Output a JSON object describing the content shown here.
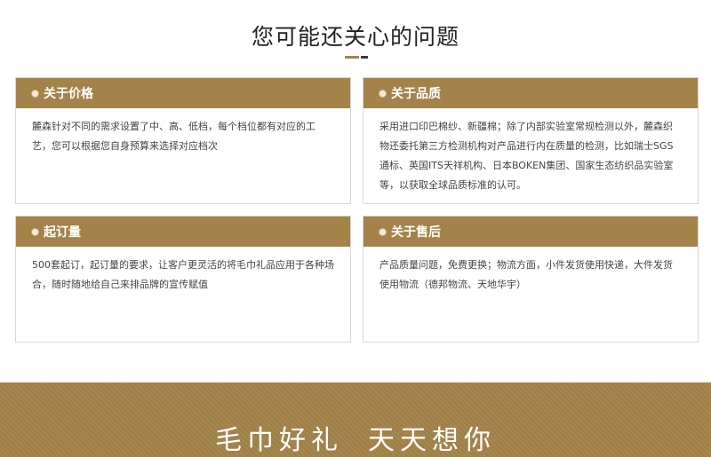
{
  "page": {
    "title": "您可能还关心的问题"
  },
  "cards": [
    {
      "heading": "关于价格",
      "body": "麓森针对不同的需求设置了中、高、低档，每个档位都有对应的工艺，您可以根据您自身预算来选择对应档次"
    },
    {
      "heading": "关于品质",
      "body": "采用进口印巴棉纱、新疆棉；除了内部实验室常规检测以外，麓森织物还委托第三方检测机构对产品进行内在质量的检测，比如瑞士SGS通标、英国ITS天祥机构、日本BOKEN集团、国家生态纺织品实验室等，以获取全球品质标准的认可。"
    },
    {
      "heading": "起订量",
      "body": "500套起订，起订量的要求，让客户更灵活的将毛巾礼品应用于各种场合，随时随地给自己来排品牌的宣传赋值"
    },
    {
      "heading": "关于售后",
      "body": "产品质量问题，免费更换；物流方面，小件发货使用快递，大件发货使用物流（德邦物流、天地华宇）"
    }
  ],
  "banner": {
    "slogan_left": "毛巾好礼",
    "slogan_right": "天天想你"
  },
  "colors": {
    "accent": "#a3834a",
    "divider_dark": "#3a3a3a"
  }
}
